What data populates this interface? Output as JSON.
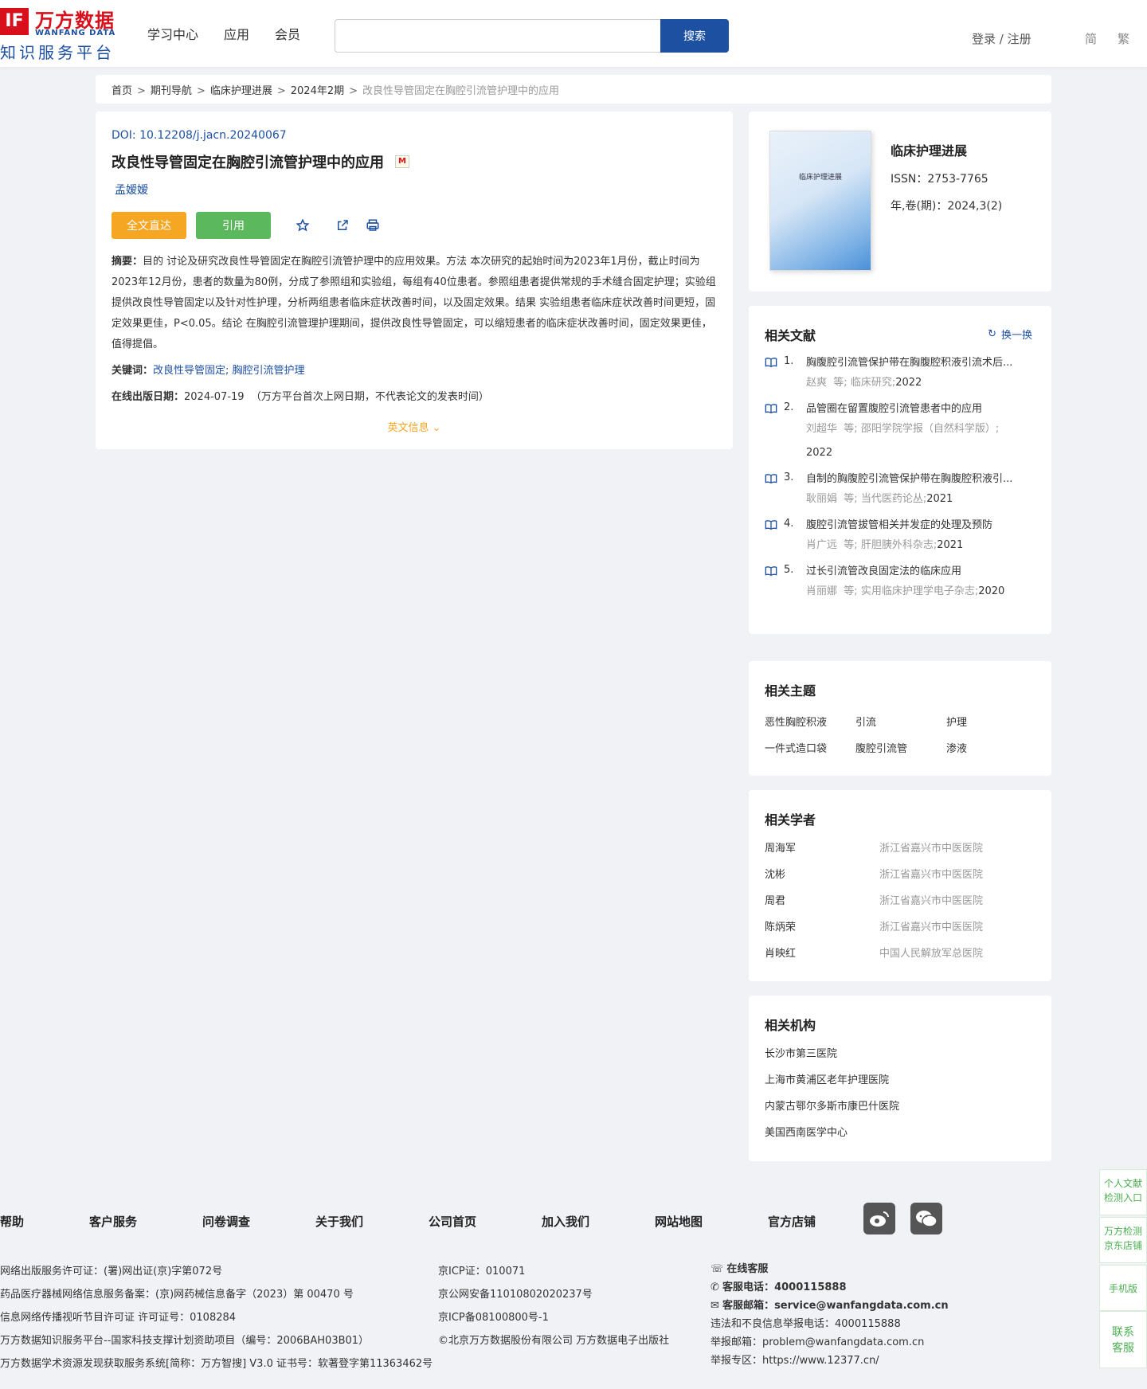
{
  "header": {
    "logo_cn": "万方数据",
    "logo_en": "WANFANG DATA",
    "logo_sub": "知识服务平台",
    "logo_mark": "IF",
    "nav": [
      "学习中心",
      "应用",
      "会员"
    ],
    "search_placeholder": "",
    "search_button": "搜索",
    "login": "登录 / 注册",
    "lang_simplified": "简",
    "lang_traditional": "繁"
  },
  "breadcrumb": [
    "首页",
    "期刊导航",
    "临床护理进展",
    "2024年2期",
    "改良性导管固定在胸腔引流管护理中的应用"
  ],
  "article": {
    "doi": "DOI: 10.12208/j.jacn.20240067",
    "title": "改良性导管固定在胸腔引流管护理中的应用",
    "badge": "M",
    "author": "孟嫒嫒",
    "fulltext_button": "全文直达",
    "cite_button": "引用",
    "abstract_label": "摘要：",
    "abstract": "目的 讨论及研究改良性导管固定在胸腔引流管护理中的应用效果。方法 本次研究的起始时间为2023年1月份，截止时间为2023年12月份，患者的数量为80例，分成了参照组和实验组，每组有40位患者。参照组患者提供常规的手术缝合固定护理；实验组提供改良性导管固定以及针对性护理，分析两组患者临床症状改善时间，以及固定效果。结果 实验组患者临床症状改善时间更短，固定效果更佳，P<0.05。结论 在胸腔引流管理护理期间，提供改良性导管固定，可以缩短患者的临床症状改善时间，固定效果更佳，值得提倡。",
    "keywords_label": "关键词：",
    "keywords": [
      "改良性导管固定",
      "胸腔引流管护理"
    ],
    "pubdate_label": "在线出版日期：",
    "pubdate": "2024-07-19",
    "pubdate_note": "（万方平台首次上网日期，不代表论文的发表时间）",
    "english_info": "英文信息"
  },
  "journal": {
    "cover_title": "临床护理进展",
    "name": "临床护理进展",
    "issn": "ISSN：2753-7765",
    "volume": "年,卷(期)：2024,3(2)"
  },
  "related_refs": {
    "title": "相关文献",
    "refresh": "换一换",
    "items": [
      {
        "num": "1.",
        "title": "胸腹腔引流管保护带在胸腹腔积液引流术后...",
        "authors": "赵爽",
        "etc": "等;",
        "source": "临床研究;",
        "year": "2022"
      },
      {
        "num": "2.",
        "title": "品管圈在留置腹腔引流管患者中的应用",
        "authors": "刘超华",
        "etc": "等;",
        "source": "邵阳学院学报（自然科学版）;",
        "year": "2022"
      },
      {
        "num": "3.",
        "title": "自制的胸腹腔引流管保护带在胸腹腔积液引...",
        "authors": "耿丽娟",
        "etc": "等;",
        "source": "当代医药论丛;",
        "year": "2021"
      },
      {
        "num": "4.",
        "title": "腹腔引流管拔管相关并发症的处理及预防",
        "authors": "肖广远",
        "etc": "等;",
        "source": "肝胆胰外科杂志;",
        "year": "2021"
      },
      {
        "num": "5.",
        "title": "过长引流管改良固定法的临床应用",
        "authors": "肖丽娜",
        "etc": "等;",
        "source": "实用临床护理学电子杂志;",
        "year": "2020"
      }
    ]
  },
  "related_topics": {
    "title": "相关主题",
    "items": [
      "恶性胸腔积液",
      "引流",
      "护理",
      "一件式造口袋",
      "腹腔引流管",
      "渗液"
    ]
  },
  "related_scholars": {
    "title": "相关学者",
    "items": [
      {
        "name": "周海军",
        "org": "浙江省嘉兴市中医医院"
      },
      {
        "name": "沈彬",
        "org": "浙江省嘉兴市中医医院"
      },
      {
        "name": "周君",
        "org": "浙江省嘉兴市中医医院"
      },
      {
        "name": "陈炳荣",
        "org": "浙江省嘉兴市中医医院"
      },
      {
        "name": "肖映红",
        "org": "中国人民解放军总医院"
      }
    ]
  },
  "related_orgs": {
    "title": "相关机构",
    "items": [
      "长沙市第三医院",
      "上海市黄浦区老年护理医院",
      "内蒙古鄂尔多斯市康巴什医院",
      "美国西南医学中心"
    ]
  },
  "footer": {
    "links": [
      "帮助",
      "客户服务",
      "问卷调查",
      "关于我们",
      "公司首页",
      "加入我们",
      "网站地图",
      "官方店铺"
    ],
    "col1": [
      "网络出版服务许可证：(署)网出证(京)字第072号",
      "药品医疗器械网络信息服务备案：(京)网药械信息备字（2023）第 00470 号",
      "信息网络传播视听节目许可证 许可证号：0108284",
      "万方数据知识服务平台--国家科技支撑计划资助项目（编号：2006BAH03B01）",
      "万方数据学术资源发现获取服务系统[简称：万方智搜] V3.0 证书号：软著登字第11363462号"
    ],
    "col2": [
      "京ICP证：010071",
      "京公网安备11010802020237号",
      "京ICP备08100800号-1",
      "©北京万方数据股份有限公司 万方数据电子出版社"
    ],
    "col3": {
      "online_service": "在线客服",
      "phone_label": "客服电话：",
      "phone": "4000115888",
      "email_label": "客服邮箱：",
      "email": "service@wanfangdata.com.cn",
      "report_phone": "违法和不良信息举报电话：4000115888",
      "report_email": "举报邮箱：problem@wanfangdata.com.cn",
      "report_site": "举报专区：https://www.12377.cn/"
    }
  },
  "side": {
    "personal": [
      "个人文献",
      "检测入口"
    ],
    "jd": [
      "万方检测",
      "京东店铺"
    ],
    "mobile": "手机版",
    "contact": [
      "联系",
      "客服"
    ]
  }
}
